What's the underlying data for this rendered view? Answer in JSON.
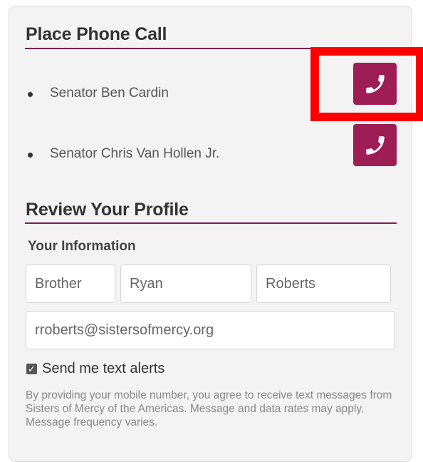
{
  "place_call": {
    "title": "Place Phone Call",
    "senators": [
      {
        "name": "Senator Ben Cardin",
        "icon": "phone-icon"
      },
      {
        "name": "Senator Chris Van Hollen Jr.",
        "icon": "phone-icon"
      }
    ]
  },
  "profile": {
    "title": "Review Your Profile",
    "info_label": "Your Information",
    "fields": {
      "prefix": "Brother",
      "first_name": "Ryan",
      "last_name": "Roberts",
      "email": "rroberts@sistersofmercy.org"
    },
    "text_alerts": {
      "checked": true,
      "label": "Send me text alerts"
    },
    "disclaimer": "By providing your mobile number, you agree to receive text messages from Sisters of Mercy of the Americas. Message and data rates may apply. Message frequency varies."
  },
  "colors": {
    "accent": "#9e1d55",
    "highlight": "#ff0000",
    "panel_bg": "#f3f3f3"
  }
}
